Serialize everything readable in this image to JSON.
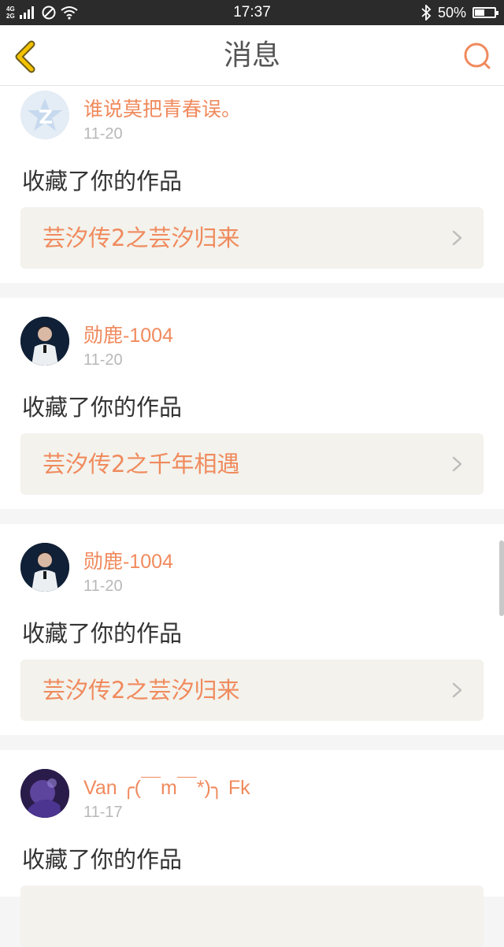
{
  "status_bar": {
    "network_top": "4G",
    "network_bottom": "2G",
    "time": "17:37",
    "battery_text": "50%",
    "battery_level": 0.5
  },
  "header": {
    "title": "消息"
  },
  "colors": {
    "accent": "#f08a5d",
    "back_icon": "#f2c200",
    "text_dark": "#333333",
    "date": "#b8b8b8",
    "link_bg": "#f3f2ec"
  },
  "messages": [
    {
      "user": "谁说莫把青春误。",
      "date": "11-20",
      "action": "收藏了你的作品",
      "work": "芸汐传2之芸汐归来",
      "avatar": "default-star-avatar"
    },
    {
      "user": "勋鹿-1004",
      "date": "11-20",
      "action": "收藏了你的作品",
      "work": "芸汐传2之千年相遇",
      "avatar": "photo-avatar"
    },
    {
      "user": "勋鹿-1004",
      "date": "11-20",
      "action": "收藏了你的作品",
      "work": "芸汐传2之芸汐归来",
      "avatar": "photo-avatar"
    },
    {
      "user": "Van ╭(￣m￣*)╮ Fk",
      "date": "11-17",
      "action": "收藏了你的作品",
      "work": "",
      "avatar": "purple-photo-avatar"
    }
  ]
}
